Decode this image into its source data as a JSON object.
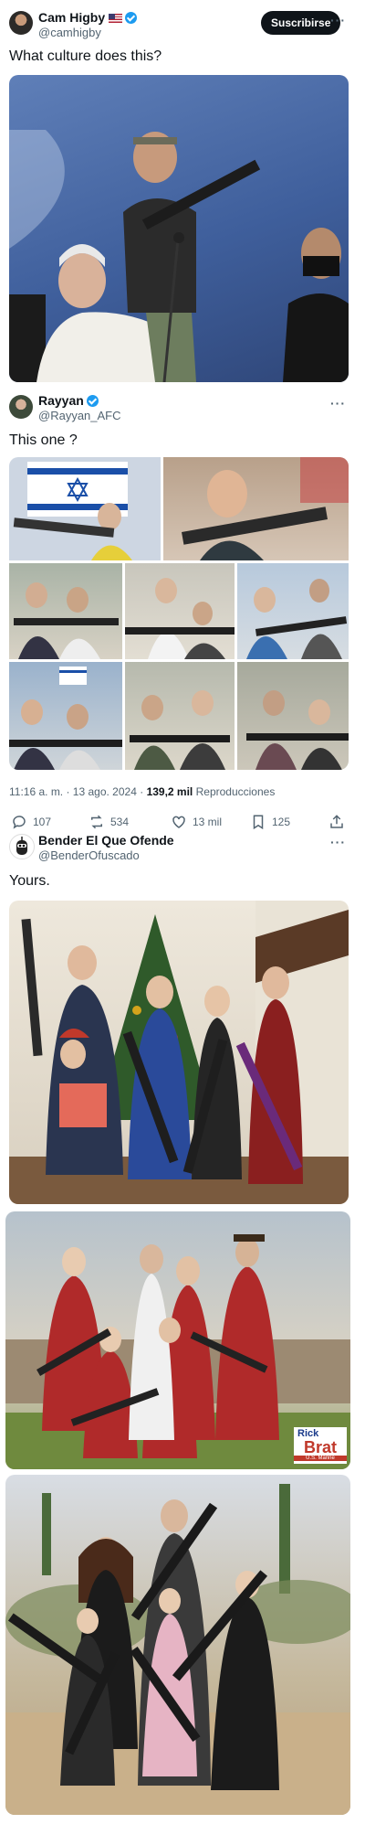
{
  "tweet1": {
    "author_name": "Cam Higby",
    "author_handle": "@camhigby",
    "subscribe_label": "Suscribirse",
    "more_label": "···",
    "text": "What culture does this?"
  },
  "tweet2": {
    "author_name": "Rayyan",
    "author_handle": "@Rayyan_AFC",
    "more_label": "···",
    "text": "This one ?",
    "time": "11:16 a. m. · 13 ago. 2024 ·",
    "views_count": "139,2 mil",
    "views_label": "Reproducciones",
    "replies": "107",
    "reposts": "534",
    "likes": "13 mil",
    "bookmarks": "125"
  },
  "tweet3": {
    "author_name": "Bender El Que Ofende",
    "author_handle": "@BenderOfuscado",
    "more_label": "···",
    "text": "Yours.",
    "watermark_top": "Rick",
    "watermark_bottom": "Brat",
    "watermark_small": "U.S. Marine"
  },
  "icons": {
    "reply": "reply-icon",
    "repost": "repost-icon",
    "like": "heart-icon",
    "bookmark": "bookmark-icon",
    "share": "share-icon",
    "verified": "verified-badge-icon",
    "flag": "us-flag-icon"
  },
  "colors": {
    "text": "#0f1419",
    "secondary": "#536471",
    "verified": "#1d9bf0",
    "subscribe_bg": "#0f1419"
  }
}
